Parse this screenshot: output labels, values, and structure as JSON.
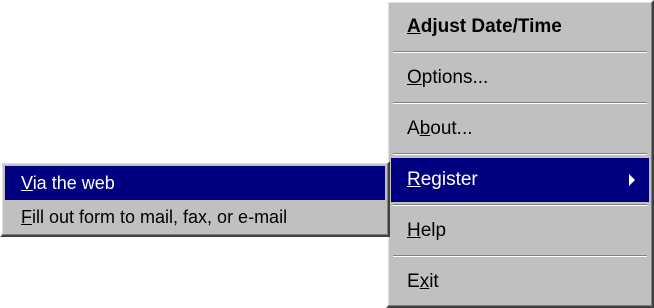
{
  "main_menu": {
    "items": [
      {
        "id": "adjust",
        "pre": "",
        "ul": "A",
        "post": "djust Date/Time"
      },
      {
        "id": "options",
        "pre": "",
        "ul": "O",
        "post": "ptions..."
      },
      {
        "id": "about",
        "pre": "A",
        "ul": "b",
        "post": "out..."
      },
      {
        "id": "register",
        "pre": "",
        "ul": "R",
        "post": "egister"
      },
      {
        "id": "help",
        "pre": "",
        "ul": "H",
        "post": "elp"
      },
      {
        "id": "exit",
        "pre": "E",
        "ul": "x",
        "post": "it"
      }
    ]
  },
  "submenu": {
    "items": [
      {
        "id": "via-web",
        "pre": "",
        "ul": "V",
        "post": "ia the web"
      },
      {
        "id": "fill-out",
        "pre": "",
        "ul": "F",
        "post": "ill out form to mail, fax, or e-mail"
      }
    ]
  },
  "colors": {
    "menu_bg": "#c0c0c0",
    "highlight": "#000080",
    "highlight_text": "#ffffff"
  }
}
